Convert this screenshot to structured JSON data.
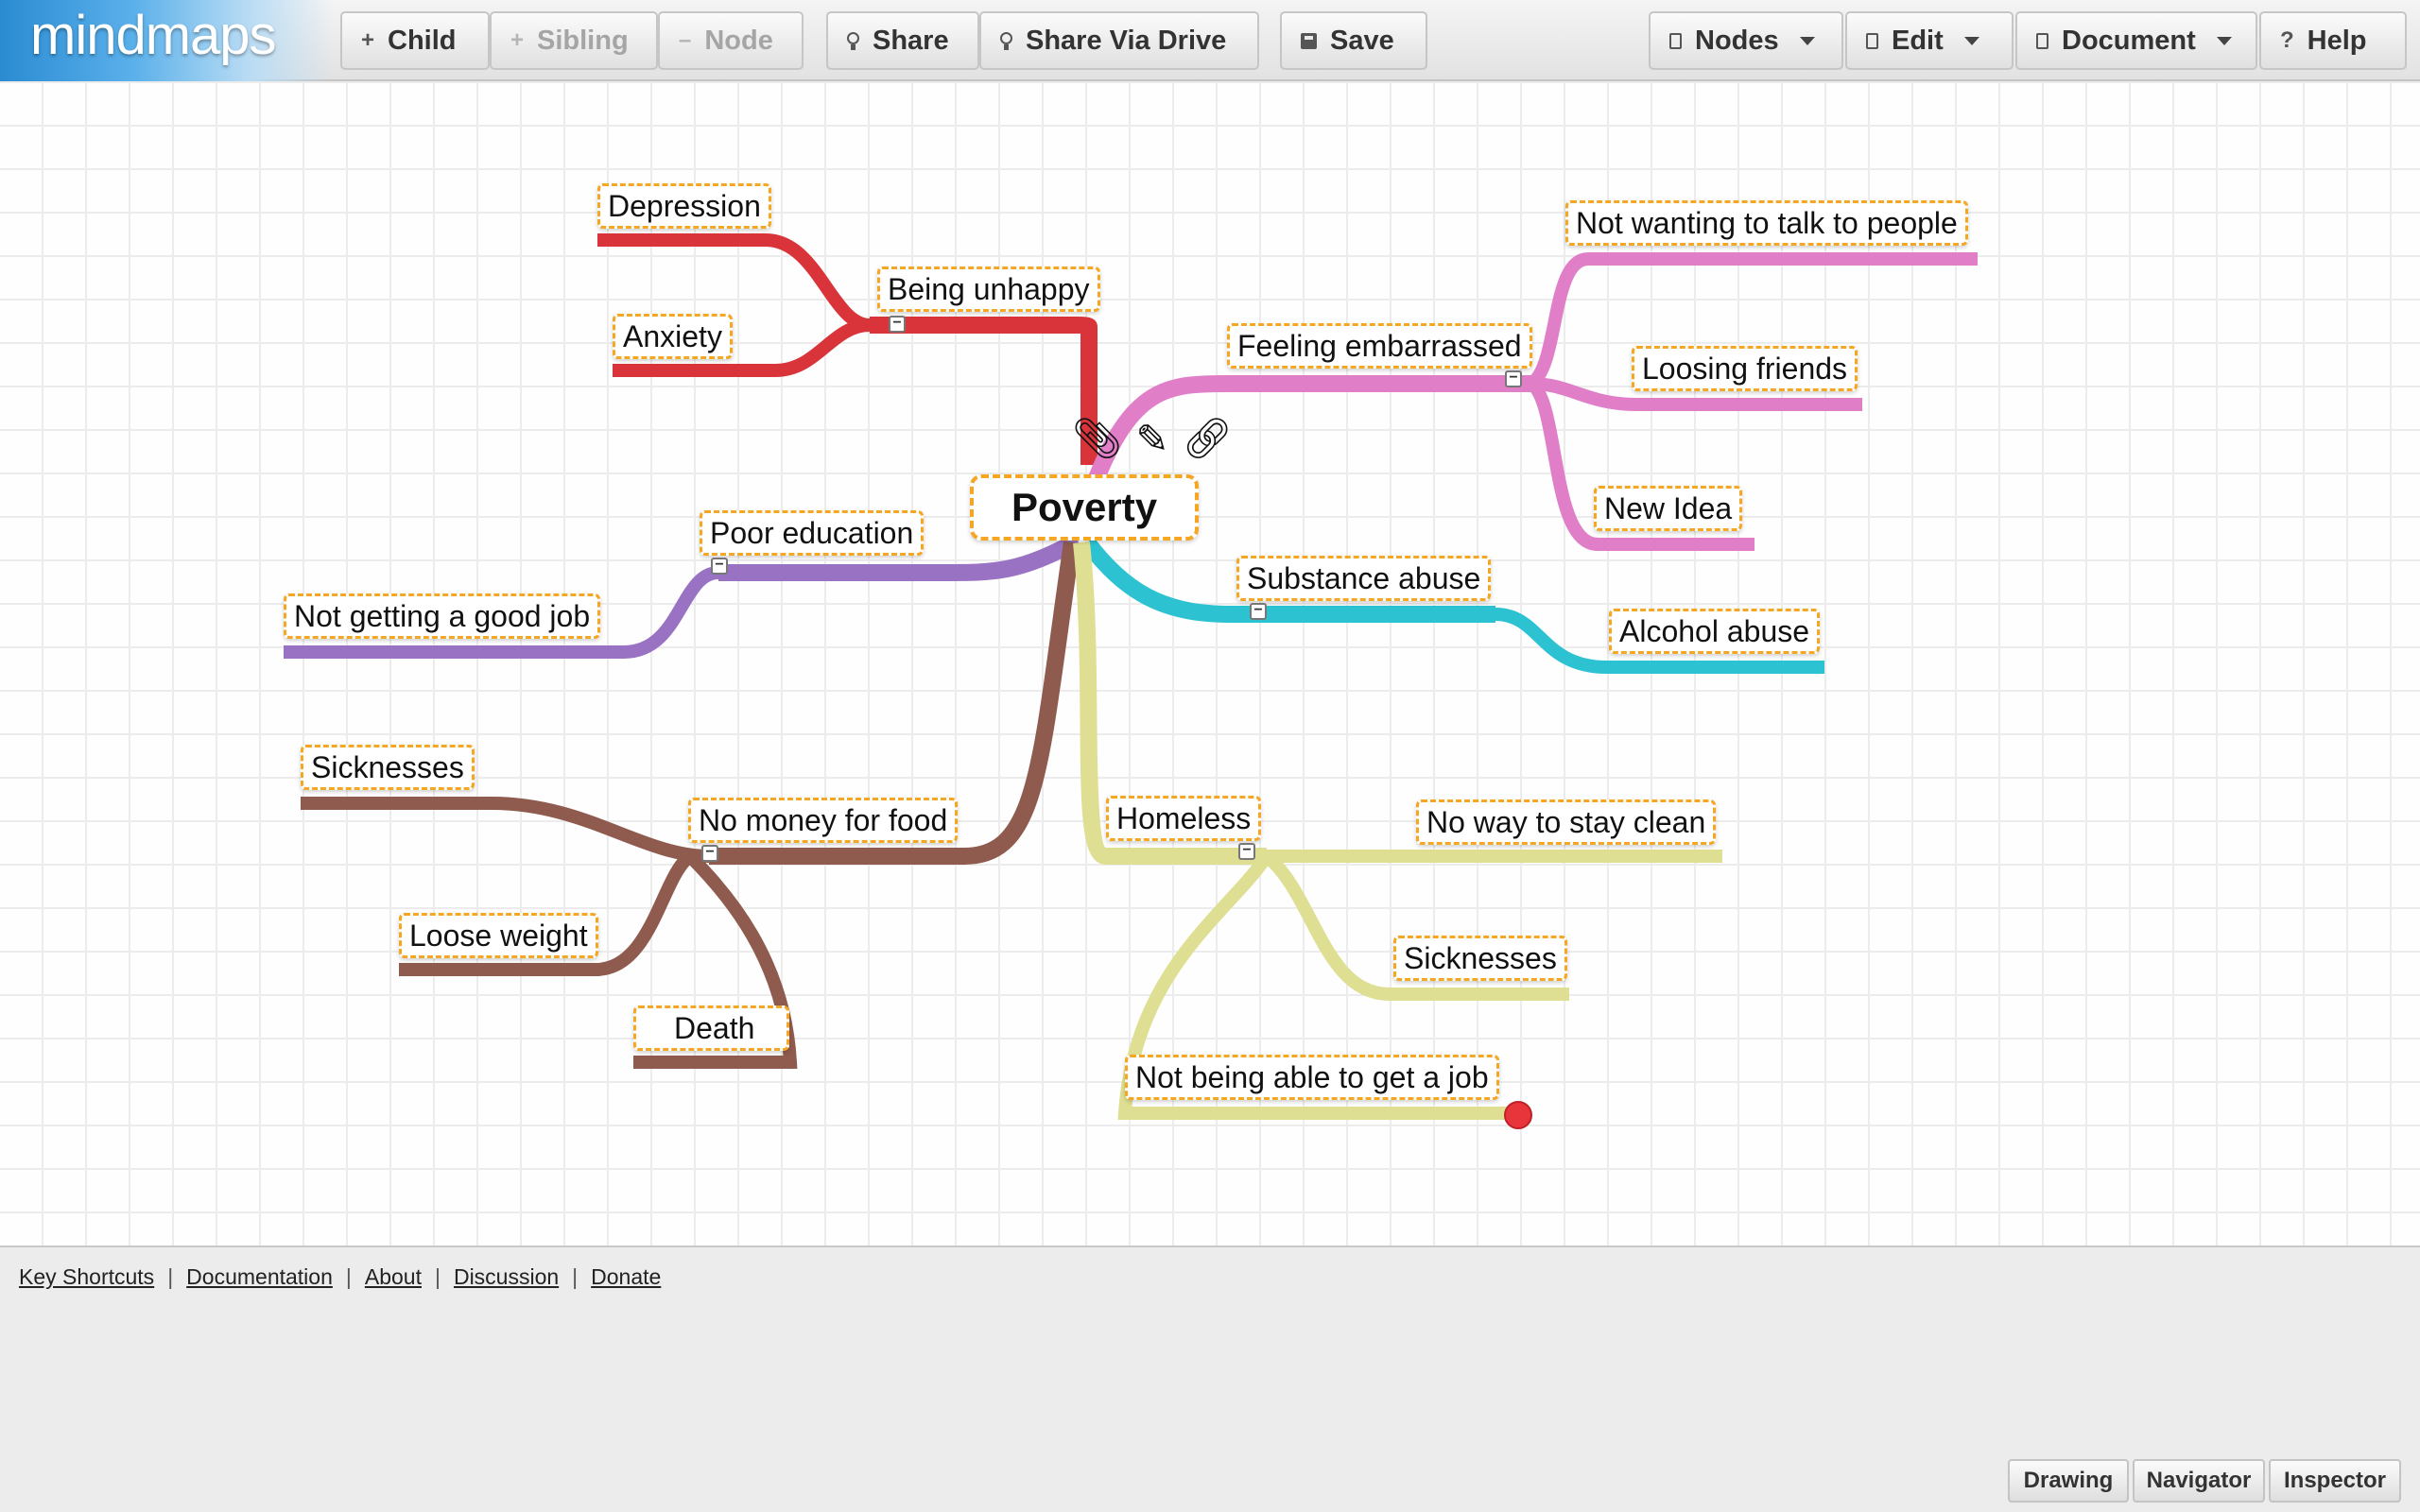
{
  "app": {
    "title": "mindmaps"
  },
  "toolbar": {
    "child_label": "Child",
    "sibling_label": "Sibling",
    "node_label": "Node",
    "share_label": "Share",
    "share_drive_label": "Share Via Drive",
    "save_label": "Save",
    "nodes_menu_label": "Nodes",
    "edit_menu_label": "Edit",
    "document_menu_label": "Document",
    "help_label": "Help"
  },
  "mindmap": {
    "root": "Poverty",
    "nodes": {
      "being_unhappy": "Being unhappy",
      "depression": "Depression",
      "anxiety": "Anxiety",
      "feeling_embarrassed": "Feeling embarrassed",
      "not_wanting_to_talk": "Not wanting to talk to people",
      "loosing_friends": "Loosing friends",
      "new_idea": "New Idea",
      "poor_education": "Poor education",
      "not_getting_job": "Not getting a good job",
      "substance_abuse": "Substance abuse",
      "alcohol_abuse": "Alcohol abuse",
      "no_money_food": "No money for food",
      "sicknesses_1": "Sicknesses",
      "loose_weight": "Loose weight",
      "death": "Death",
      "homeless": "Homeless",
      "no_way_clean": "No way to stay clean",
      "sicknesses_2": "Sicknesses",
      "not_able_job": "Not being able to get a job"
    },
    "branch_colors": {
      "red": "#d9343a",
      "pink": "#e07fc8",
      "purple": "#9a72c4",
      "cyan": "#2cc2d2",
      "brown": "#8e5b4e",
      "yellow": "#dedf92"
    }
  },
  "footer": {
    "links": [
      "Key Shortcuts",
      "Documentation",
      "About",
      "Discussion",
      "Donate"
    ],
    "separator": "|",
    "panels": {
      "drawing": "Drawing",
      "navigator": "Navigator",
      "inspector": "Inspector"
    }
  }
}
